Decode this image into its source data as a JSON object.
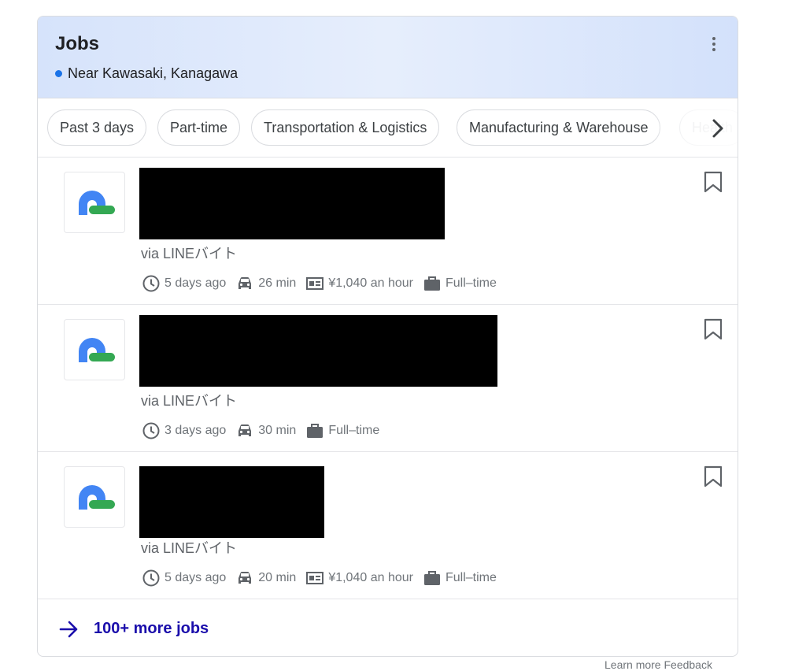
{
  "header": {
    "title": "Jobs",
    "location": "Near Kawasaki, Kanagawa",
    "more_icon": "more-vert-icon"
  },
  "chips": [
    {
      "label": "Past 3 days"
    },
    {
      "label": "Part-time"
    },
    {
      "label": "Transportation & Logistics"
    },
    {
      "label": "Manufacturing & Warehouse"
    },
    {
      "label": "Health"
    }
  ],
  "jobs": [
    {
      "title": "",
      "via": "via LINEバイト",
      "posted": "5 days ago",
      "commute": "26 min",
      "salary": "¥1,040 an hour",
      "type": "Full–time"
    },
    {
      "title": "",
      "via": "via LINEバイト",
      "posted": "3 days ago",
      "commute": "30 min",
      "salary": "",
      "type": "Full–time"
    },
    {
      "title": "",
      "via": "via LINEバイト",
      "posted": "5 days ago",
      "commute": "20 min",
      "salary": "¥1,040 an hour",
      "type": "Full–time"
    }
  ],
  "more_jobs": {
    "label": "100+ more jobs"
  },
  "footer": {
    "text": "Learn more   Feedback"
  },
  "colors": {
    "accent": "#1a73e8",
    "link": "#1a0dab",
    "logo_blue": "#4285f4",
    "logo_green": "#34a853"
  }
}
